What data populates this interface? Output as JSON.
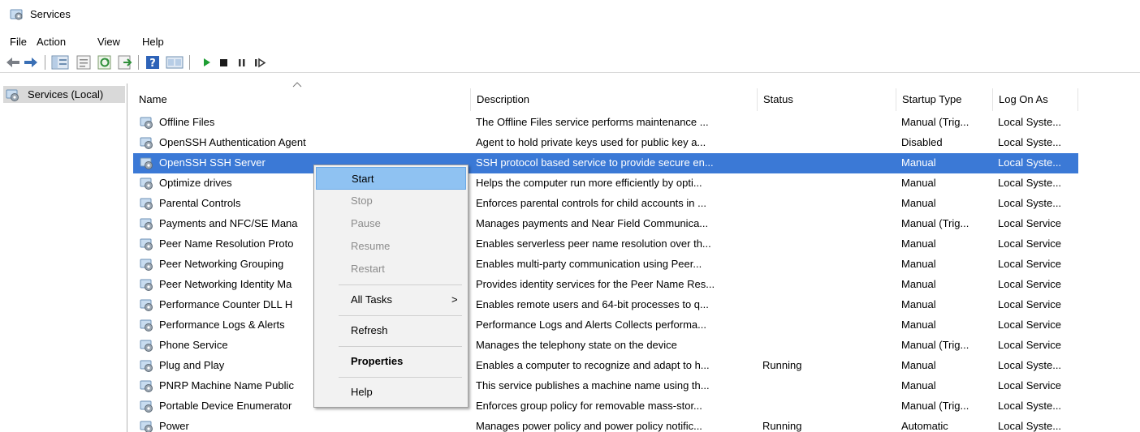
{
  "window": {
    "title": "Services"
  },
  "menu": [
    "File",
    "Action",
    "View",
    "Help"
  ],
  "toolbar": {
    "buttons": [
      "back-icon",
      "forward-icon",
      "console-tree-icon",
      "properties-icon",
      "refresh-icon",
      "export-list-icon",
      "help-icon",
      "show-hide-icon",
      "start-service-icon",
      "stop-service-icon",
      "pause-service-icon",
      "restart-service-icon"
    ]
  },
  "tree": {
    "root_label": "Services (Local)"
  },
  "table": {
    "columns": [
      "Name",
      "Description",
      "Status",
      "Startup Type",
      "Log On As"
    ],
    "rows": [
      {
        "name": "Offline Files",
        "description": "The Offline Files service performs maintenance ...",
        "status": "",
        "startup": "Manual (Trig...",
        "logon": "Local Syste..."
      },
      {
        "name": "OpenSSH Authentication Agent",
        "description": "Agent to hold private keys used for public key a...",
        "status": "",
        "startup": "Disabled",
        "logon": "Local Syste..."
      },
      {
        "name": "OpenSSH SSH Server",
        "description": "SSH protocol based service to provide secure en...",
        "status": "",
        "startup": "Manual",
        "logon": "Local Syste...",
        "selected": true
      },
      {
        "name": "Optimize drives",
        "description": "Helps the computer run more efficiently by opti...",
        "status": "",
        "startup": "Manual",
        "logon": "Local Syste..."
      },
      {
        "name": "Parental Controls",
        "description": "Enforces parental controls for child accounts in ...",
        "status": "",
        "startup": "Manual",
        "logon": "Local Syste..."
      },
      {
        "name": "Payments and NFC/SE Mana",
        "description": "Manages payments and Near Field Communica...",
        "status": "",
        "startup": "Manual (Trig...",
        "logon": "Local Service"
      },
      {
        "name": "Peer Name Resolution Proto",
        "description": "Enables serverless peer name resolution over th...",
        "status": "",
        "startup": "Manual",
        "logon": "Local Service"
      },
      {
        "name": "Peer Networking Grouping",
        "description": "Enables multi-party communication using Peer...",
        "status": "",
        "startup": "Manual",
        "logon": "Local Service"
      },
      {
        "name": "Peer Networking Identity Ma",
        "description": "Provides identity services for the Peer Name Res...",
        "status": "",
        "startup": "Manual",
        "logon": "Local Service"
      },
      {
        "name": "Performance Counter DLL H",
        "description": "Enables remote users and 64-bit processes to q...",
        "status": "",
        "startup": "Manual",
        "logon": "Local Service"
      },
      {
        "name": "Performance Logs & Alerts",
        "description": "Performance Logs and Alerts Collects performa...",
        "status": "",
        "startup": "Manual",
        "logon": "Local Service"
      },
      {
        "name": "Phone Service",
        "description": "Manages the telephony state on the device",
        "status": "",
        "startup": "Manual (Trig...",
        "logon": "Local Service"
      },
      {
        "name": "Plug and Play",
        "description": "Enables a computer to recognize and adapt to h...",
        "status": "Running",
        "startup": "Manual",
        "logon": "Local Syste..."
      },
      {
        "name": "PNRP Machine Name Public",
        "description": "This service publishes a machine name using th...",
        "status": "",
        "startup": "Manual",
        "logon": "Local Service"
      },
      {
        "name": "Portable Device Enumerator",
        "description": "Enforces group policy for removable mass-stor...",
        "status": "",
        "startup": "Manual (Trig...",
        "logon": "Local Syste..."
      },
      {
        "name": "Power",
        "description": "Manages power policy and power policy notific...",
        "status": "Running",
        "startup": "Automatic",
        "logon": "Local Syste..."
      }
    ]
  },
  "context_menu": {
    "items": [
      {
        "label": "Start",
        "state": "highlighted"
      },
      {
        "label": "Stop",
        "state": "disabled"
      },
      {
        "label": "Pause",
        "state": "disabled"
      },
      {
        "label": "Resume",
        "state": "disabled"
      },
      {
        "label": "Restart",
        "state": "disabled"
      },
      {
        "label": "All Tasks",
        "state": "submenu",
        "arrow": ">"
      },
      {
        "label": "Refresh",
        "state": "normal"
      },
      {
        "label": "Properties",
        "state": "bold"
      },
      {
        "label": "Help",
        "state": "normal"
      }
    ]
  },
  "colors": {
    "selection": "#3b79d6",
    "menu_highlight": "#8fc2f2",
    "play_green": "#1e9e33"
  }
}
